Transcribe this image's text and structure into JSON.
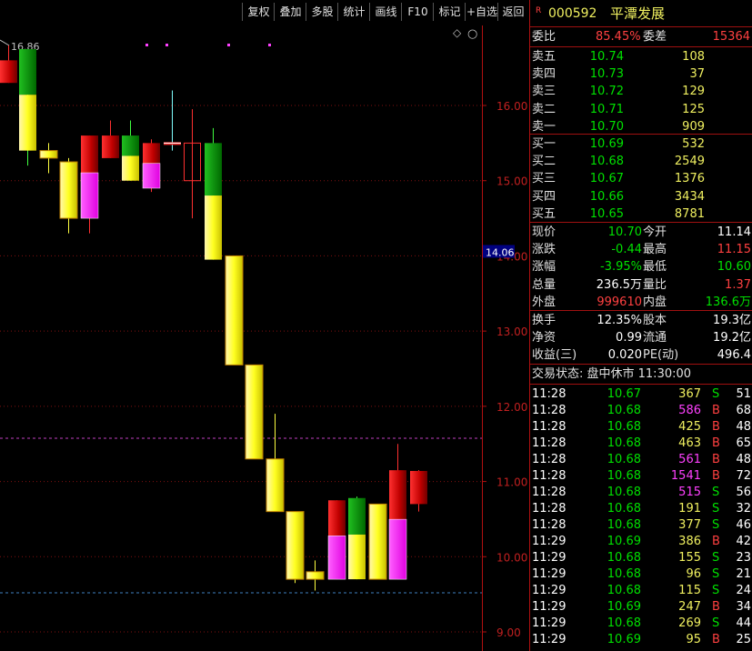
{
  "toolbar": {
    "buttons": [
      "复权",
      "叠加",
      "多股",
      "统计",
      "画线",
      "F10",
      "标记",
      "+自选",
      "返回"
    ]
  },
  "chart_data": {
    "type": "candlestick",
    "y_ticks": [
      16.0,
      15.0,
      14.0,
      13.0,
      12.0,
      11.0,
      10.0,
      9.0
    ],
    "ylim": [
      8.8,
      16.75
    ],
    "current_price_label": "14.06",
    "high_marker_label": "16.86",
    "candles": [
      {
        "o": 16.6,
        "h": 16.8,
        "l": 16.3,
        "c": 16.3,
        "body": "red"
      },
      {
        "o": 15.4,
        "h": 16.75,
        "l": 15.2,
        "c": 16.75,
        "body": "green_yellow"
      },
      {
        "o": 15.3,
        "h": 15.5,
        "l": 15.1,
        "c": 15.4,
        "body": "yellow"
      },
      {
        "o": 14.5,
        "h": 15.3,
        "l": 14.3,
        "c": 15.25,
        "body": "yellow"
      },
      {
        "o": 14.5,
        "h": 15.6,
        "l": 14.3,
        "c": 15.6,
        "body": "red_magenta"
      },
      {
        "o": 15.3,
        "h": 15.8,
        "l": 15.3,
        "c": 15.6,
        "body": "red"
      },
      {
        "o": 15.0,
        "h": 15.8,
        "l": 15.0,
        "c": 15.6,
        "body": "green_yellow"
      },
      {
        "o": 14.9,
        "h": 15.55,
        "l": 14.85,
        "c": 15.5,
        "body": "red_magenta"
      },
      {
        "o": 15.45,
        "h": 16.2,
        "l": 15.4,
        "c": 15.5,
        "body": "flat"
      },
      {
        "o": 15.0,
        "h": 15.95,
        "l": 14.5,
        "c": 15.5,
        "body": "red_hollow"
      },
      {
        "o": 13.95,
        "h": 15.7,
        "l": 13.95,
        "c": 15.5,
        "body": "green_yellow"
      },
      {
        "o": 12.55,
        "h": 14.0,
        "l": 12.55,
        "c": 14.0,
        "body": "yellow"
      },
      {
        "o": 11.3,
        "h": 12.55,
        "l": 11.3,
        "c": 12.55,
        "body": "yellow"
      },
      {
        "o": 10.6,
        "h": 11.9,
        "l": 10.6,
        "c": 11.3,
        "body": "yellow"
      },
      {
        "o": 9.7,
        "h": 10.6,
        "l": 9.65,
        "c": 10.6,
        "body": "yellow"
      },
      {
        "o": 9.7,
        "h": 9.95,
        "l": 9.55,
        "c": 9.8,
        "body": "yellow"
      },
      {
        "o": 9.7,
        "h": 10.75,
        "l": 9.7,
        "c": 10.75,
        "body": "red_magenta"
      },
      {
        "o": 9.7,
        "h": 10.8,
        "l": 9.7,
        "c": 10.78,
        "body": "green_yellow"
      },
      {
        "o": 9.7,
        "h": 10.7,
        "l": 9.7,
        "c": 10.7,
        "body": "yellow"
      },
      {
        "o": 9.7,
        "h": 11.5,
        "l": 9.7,
        "c": 11.15,
        "body": "red_magenta"
      },
      {
        "o": 10.7,
        "h": 11.15,
        "l": 10.6,
        "c": 11.14,
        "body": "red"
      }
    ]
  },
  "stock": {
    "code": "000592",
    "name": "平潭发展",
    "tag": "R"
  },
  "summary": {
    "weibi_label": "委比",
    "weibi_value": "85.45%",
    "weicha_label": "委差",
    "weicha_value": "15364"
  },
  "sell": [
    {
      "label": "卖五",
      "price": "10.74",
      "vol": "108"
    },
    {
      "label": "卖四",
      "price": "10.73",
      "vol": "37"
    },
    {
      "label": "卖三",
      "price": "10.72",
      "vol": "129"
    },
    {
      "label": "卖二",
      "price": "10.71",
      "vol": "125"
    },
    {
      "label": "卖一",
      "price": "10.70",
      "vol": "909"
    }
  ],
  "buy": [
    {
      "label": "买一",
      "price": "10.69",
      "vol": "532"
    },
    {
      "label": "买二",
      "price": "10.68",
      "vol": "2549"
    },
    {
      "label": "买三",
      "price": "10.67",
      "vol": "1376"
    },
    {
      "label": "买四",
      "price": "10.66",
      "vol": "3434"
    },
    {
      "label": "买五",
      "price": "10.65",
      "vol": "8781"
    }
  ],
  "quote": [
    {
      "l1": "现价",
      "v1": "10.70",
      "c1": "green",
      "l2": "今开",
      "v2": "11.14",
      "c2": "white"
    },
    {
      "l1": "涨跌",
      "v1": "-0.44",
      "c1": "green",
      "l2": "最高",
      "v2": "11.15",
      "c2": "red"
    },
    {
      "l1": "涨幅",
      "v1": "-3.95%",
      "c1": "green",
      "l2": "最低",
      "v2": "10.60",
      "c2": "green"
    },
    {
      "l1": "总量",
      "v1": "236.5万",
      "c1": "white",
      "l2": "量比",
      "v2": "1.37",
      "c2": "red"
    },
    {
      "l1": "外盘",
      "v1": "999610",
      "c1": "red",
      "l2": "内盘",
      "v2": "136.6万",
      "c2": "green"
    }
  ],
  "stats": [
    {
      "l1": "换手",
      "v1": "12.35%",
      "l2": "股本",
      "v2": "19.3亿"
    },
    {
      "l1": "净资",
      "v1": "0.99",
      "l2": "流通",
      "v2": "19.2亿"
    },
    {
      "l1": "收益(三)",
      "v1": "0.020",
      "l2": "PE(动)",
      "v2": "496.4"
    }
  ],
  "status": "交易状态: 盘中休市 11:30:00",
  "ticks": [
    {
      "t": "11:28",
      "p": "10.67",
      "v": "367",
      "vc": "yellow",
      "bs": "S",
      "n": "51"
    },
    {
      "t": "11:28",
      "p": "10.68",
      "v": "586",
      "vc": "magenta",
      "bs": "B",
      "n": "68"
    },
    {
      "t": "11:28",
      "p": "10.68",
      "v": "425",
      "vc": "yellow",
      "bs": "B",
      "n": "48"
    },
    {
      "t": "11:28",
      "p": "10.68",
      "v": "463",
      "vc": "yellow",
      "bs": "B",
      "n": "65"
    },
    {
      "t": "11:28",
      "p": "10.68",
      "v": "561",
      "vc": "magenta",
      "bs": "B",
      "n": "48"
    },
    {
      "t": "11:28",
      "p": "10.68",
      "v": "1541",
      "vc": "magenta",
      "bs": "B",
      "n": "72"
    },
    {
      "t": "11:28",
      "p": "10.68",
      "v": "515",
      "vc": "magenta",
      "bs": "S",
      "n": "56"
    },
    {
      "t": "11:28",
      "p": "10.68",
      "v": "191",
      "vc": "yellow",
      "bs": "S",
      "n": "32"
    },
    {
      "t": "11:28",
      "p": "10.68",
      "v": "377",
      "vc": "yellow",
      "bs": "S",
      "n": "46"
    },
    {
      "t": "11:29",
      "p": "10.69",
      "v": "386",
      "vc": "yellow",
      "bs": "B",
      "n": "42"
    },
    {
      "t": "11:29",
      "p": "10.68",
      "v": "155",
      "vc": "yellow",
      "bs": "S",
      "n": "23"
    },
    {
      "t": "11:29",
      "p": "10.68",
      "v": "96",
      "vc": "yellow",
      "bs": "S",
      "n": "21"
    },
    {
      "t": "11:29",
      "p": "10.68",
      "v": "115",
      "vc": "yellow",
      "bs": "S",
      "n": "24"
    },
    {
      "t": "11:29",
      "p": "10.69",
      "v": "247",
      "vc": "yellow",
      "bs": "B",
      "n": "34"
    },
    {
      "t": "11:29",
      "p": "10.68",
      "v": "269",
      "vc": "yellow",
      "bs": "S",
      "n": "44"
    },
    {
      "t": "11:29",
      "p": "10.69",
      "v": "95",
      "vc": "yellow",
      "bs": "B",
      "n": "25"
    }
  ]
}
